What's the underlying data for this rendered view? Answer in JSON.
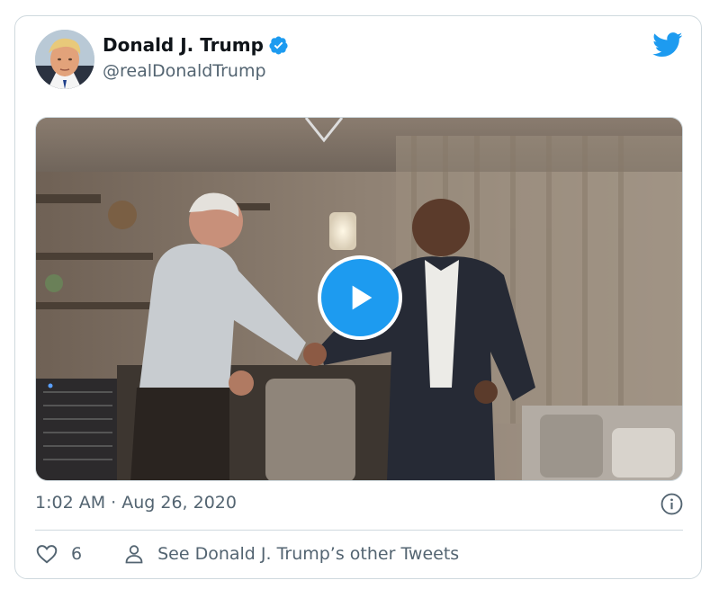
{
  "tweet": {
    "author": {
      "display_name": "Donald J. Trump",
      "handle": "@realDonaldTrump",
      "verified": true
    },
    "timestamp": "1:02 AM · Aug 26, 2020",
    "like_count": "6",
    "see_other_label": "See Donald J. Trump’s other Tweets"
  },
  "media": {
    "type": "video"
  },
  "icons": {
    "brand": "twitter-bird-icon",
    "verified": "verified-badge-icon",
    "play": "play-icon",
    "info": "info-icon",
    "like": "heart-icon",
    "profile": "person-icon"
  },
  "colors": {
    "accent": "#1d9bf0",
    "text_primary": "#0f1419",
    "text_secondary": "#536471",
    "border": "#cfd9de"
  }
}
